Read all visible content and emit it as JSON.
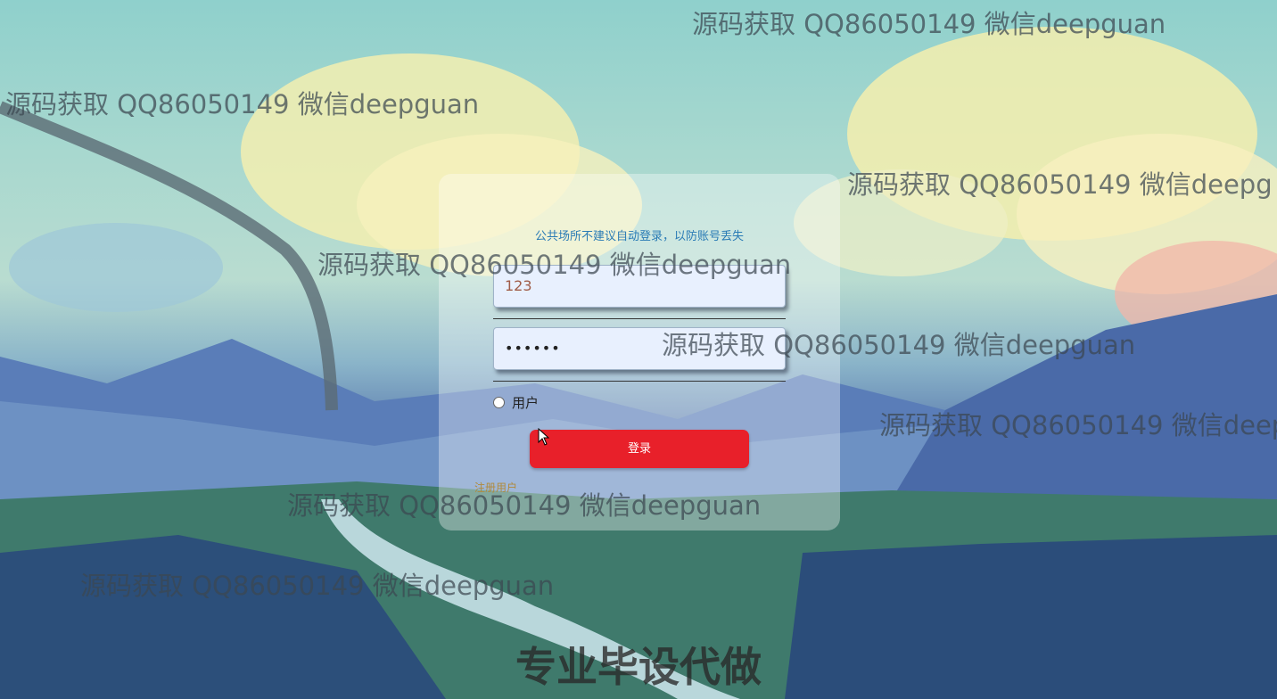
{
  "login": {
    "notice": "公共场所不建议自动登录，以防账号丢失",
    "username_value": "123",
    "password_mask": "••••••",
    "role_label": "用户",
    "login_button": "登录",
    "register_link": "注册用户"
  },
  "watermarks": {
    "w1": "源码获取 QQ86050149 微信deepguan",
    "w2": "源码获取 QQ86050149 微信deepguan",
    "w3": "源码获取 QQ86050149 微信deepg",
    "w4": "源码获取 QQ86050149 微信deepguan",
    "w5": "源码获取 QQ86050149 微信deepguan",
    "w6": "源码获取 QQ86050149 微信deep",
    "w7": "源码获取 QQ86050149 微信deepguan",
    "w8": "源码获取 QQ86050149 微信deepguan"
  },
  "footer": "专业毕设代做",
  "colors": {
    "accent_button": "#e8202a",
    "notice_text": "#2a7bb5"
  }
}
